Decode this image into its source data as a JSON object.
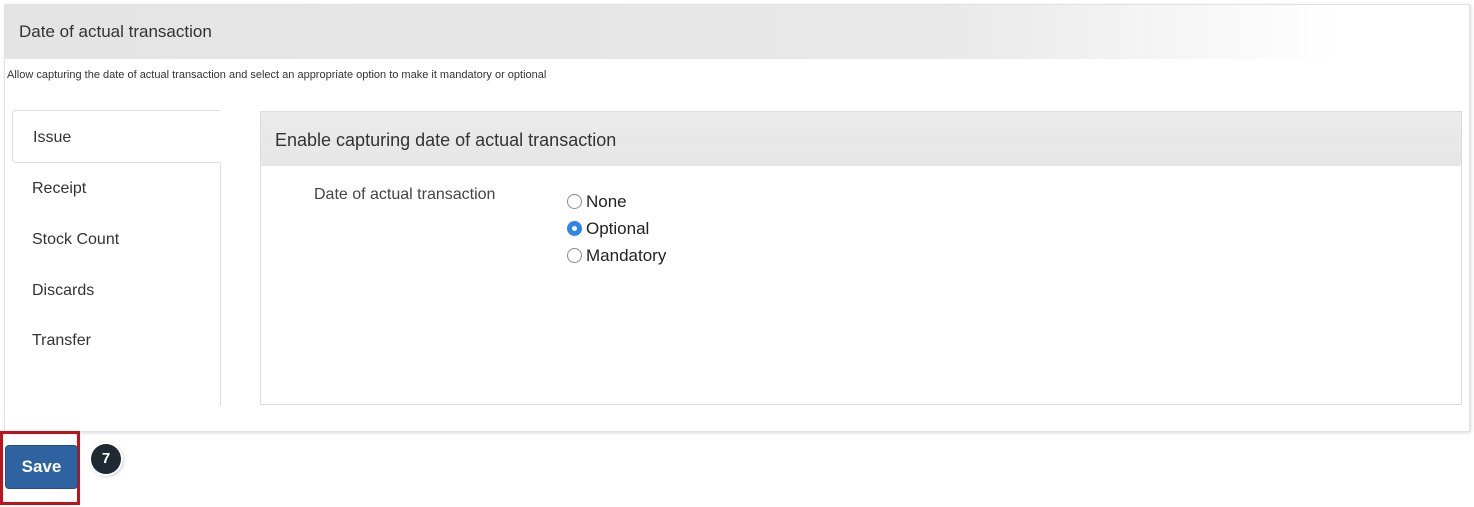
{
  "section": {
    "title": "Date of actual transaction",
    "description": "Allow capturing the date of actual transaction and select an appropriate option to make it mandatory or optional"
  },
  "tabs": [
    {
      "label": "Issue",
      "active": true
    },
    {
      "label": "Receipt",
      "active": false
    },
    {
      "label": "Stock Count",
      "active": false
    },
    {
      "label": "Discards",
      "active": false
    },
    {
      "label": "Transfer",
      "active": false
    }
  ],
  "panel": {
    "title": "Enable capturing date of actual transaction",
    "field_label": "Date of actual transaction",
    "options": [
      {
        "label": "None",
        "checked": false
      },
      {
        "label": "Optional",
        "checked": true
      },
      {
        "label": "Mandatory",
        "checked": false
      }
    ]
  },
  "actions": {
    "save_label": "Save",
    "step_number": "7"
  },
  "colors": {
    "primary_button": "#2e62a1",
    "radio_checked": "#2e86e6",
    "highlight_border": "#c0121b",
    "badge": "#1f2933"
  }
}
